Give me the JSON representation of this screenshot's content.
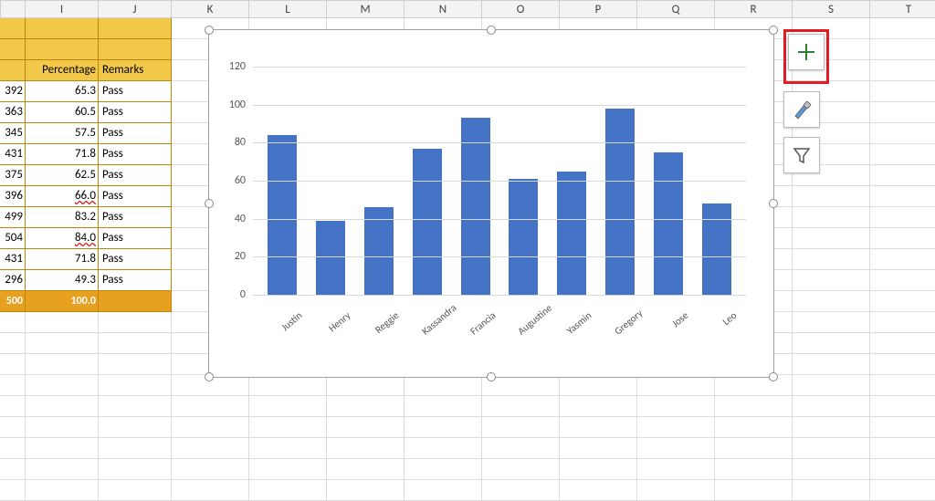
{
  "columns": [
    "I",
    "J",
    "K",
    "L",
    "M",
    "N",
    "O",
    "P",
    "Q",
    "R",
    "S",
    "T"
  ],
  "headers": {
    "percentage": "Percentage",
    "remarks": "Remarks"
  },
  "rows": [
    {
      "frag": "392",
      "pct": "65.3",
      "rem": "Pass",
      "u": false
    },
    {
      "frag": "363",
      "pct": "60.5",
      "rem": "Pass",
      "u": false
    },
    {
      "frag": "345",
      "pct": "57.5",
      "rem": "Pass",
      "u": false
    },
    {
      "frag": "431",
      "pct": "71.8",
      "rem": "Pass",
      "u": false
    },
    {
      "frag": "375",
      "pct": "62.5",
      "rem": "Pass",
      "u": false
    },
    {
      "frag": "396",
      "pct": "66.0",
      "rem": "Pass",
      "u": true
    },
    {
      "frag": "499",
      "pct": "83.2",
      "rem": "Pass",
      "u": false
    },
    {
      "frag": "504",
      "pct": "84.0",
      "rem": "Pass",
      "u": true
    },
    {
      "frag": "431",
      "pct": "71.8",
      "rem": "Pass",
      "u": false
    },
    {
      "frag": "296",
      "pct": "49.3",
      "rem": "Pass",
      "u": false
    }
  ],
  "total": {
    "frag": "500",
    "pct": "100.0"
  },
  "chart_data": {
    "type": "bar",
    "categories": [
      "Justin",
      "Henry",
      "Reggie",
      "Kassandra",
      "Francia",
      "Augustine",
      "Yasmin",
      "Gregory",
      "Jose",
      "Leo"
    ],
    "values": [
      84,
      39,
      46,
      77,
      93,
      61,
      65,
      98,
      75,
      48
    ],
    "title": "",
    "xlabel": "",
    "ylabel": "",
    "ylim": [
      0,
      120
    ],
    "yticks": [
      0,
      20,
      40,
      60,
      80,
      100,
      120
    ]
  },
  "tools": {
    "addElement": "chart-elements-button",
    "style": "chart-style-button",
    "filter": "chart-filter-button"
  }
}
